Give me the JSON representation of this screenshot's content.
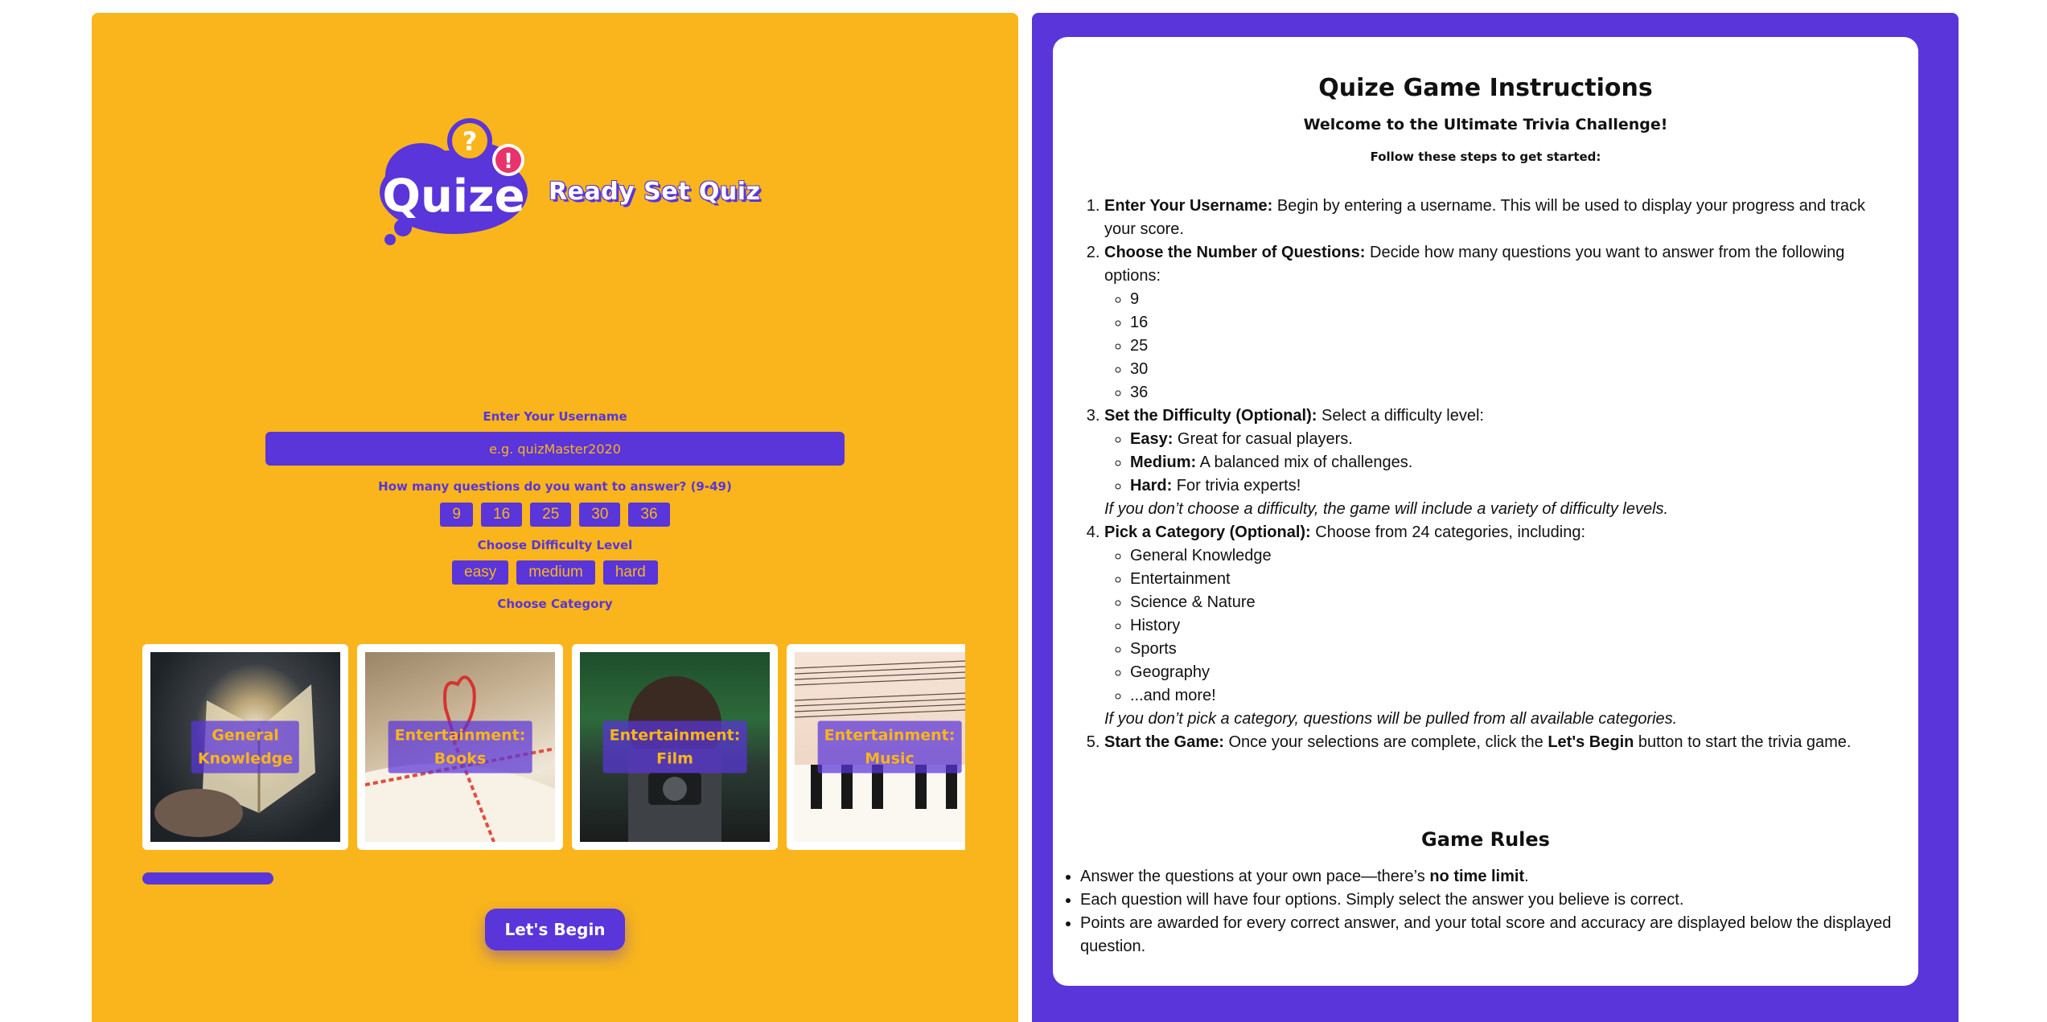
{
  "colors": {
    "accent": "#5935da",
    "background": "#f9b51b",
    "white": "#ffffff"
  },
  "logo": {
    "text": "Quize",
    "tagline": "Ready Set Quiz"
  },
  "setup": {
    "username_label": "Enter Your Username",
    "username_placeholder": "e.g. quizMaster2020",
    "questions_label": "How many questions do you want to answer? (9-49)",
    "question_options": [
      "9",
      "16",
      "25",
      "30",
      "36"
    ],
    "difficulty_label": "Choose Difficulty Level",
    "difficulty_options": [
      "easy",
      "medium",
      "hard"
    ],
    "category_label": "Choose Category",
    "categories": [
      {
        "line1": "General",
        "line2": "Knowledge"
      },
      {
        "line1": "Entertainment:",
        "line2": "Books"
      },
      {
        "line1": "Entertainment:",
        "line2": "Film"
      },
      {
        "line1": "Entertainment:",
        "line2": "Music"
      }
    ],
    "begin_label": "Let's Begin"
  },
  "instructions": {
    "title": "Quize Game Instructions",
    "subtitle": "Welcome to the Ultimate Trivia Challenge!",
    "intro": "Follow these steps to get started:",
    "step1_head": "Enter Your Username:",
    "step1_text": " Begin by entering a username. This will be used to display your progress and track your score.",
    "step2_head": "Choose the Number of Questions:",
    "step2_text": " Decide how many questions you want to answer from the following options:",
    "step2_options": [
      "9",
      "16",
      "25",
      "30",
      "36"
    ],
    "step3_head": "Set the Difficulty (Optional):",
    "step3_text": " Select a difficulty level:",
    "easy_head": "Easy:",
    "easy_text": " Great for casual players.",
    "medium_head": "Medium:",
    "medium_text": " A balanced mix of challenges.",
    "hard_head": "Hard:",
    "hard_text": " For trivia experts!",
    "step3_note": "If you don’t choose a difficulty, the game will include a variety of difficulty levels.",
    "step4_head": "Pick a Category (Optional):",
    "step4_text": " Choose from 24 categories, including:",
    "step4_options": [
      "General Knowledge",
      "Entertainment",
      "Science & Nature",
      "History",
      "Sports",
      "Geography",
      "...and more!"
    ],
    "step4_note": "If you don’t pick a category, questions will be pulled from all available categories.",
    "step5_head": "Start the Game:",
    "step5_text_a": " Once your selections are complete, click the ",
    "step5_bold": "Let's Begin",
    "step5_text_b": " button to start the trivia game.",
    "rules_title": "Game Rules",
    "rule1_a": "Answer the questions at your own pace—there’s ",
    "rule1_bold": "no time limit",
    "rule1_b": ".",
    "rule2": "Each question will have four options. Simply select the answer you believe is correct.",
    "rule3": "Points are awarded for every correct answer, and your total score and accuracy are displayed below the displayed question."
  }
}
